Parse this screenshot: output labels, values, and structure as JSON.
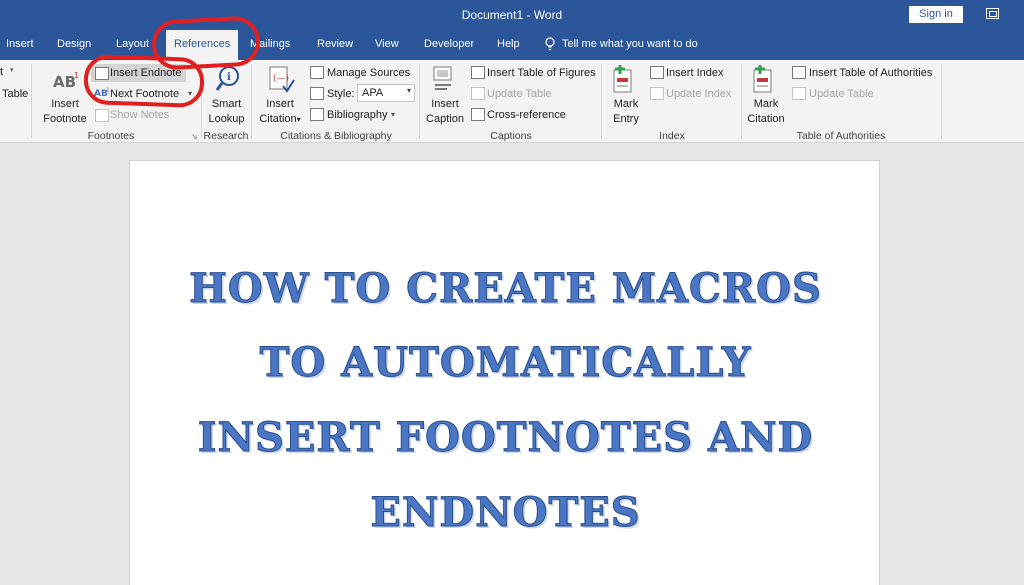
{
  "titlebar": {
    "doc_title": "Document1  -  Word",
    "signin_label": "Sign in"
  },
  "tabs": [
    {
      "label": "Insert"
    },
    {
      "label": "Design"
    },
    {
      "label": "Layout"
    },
    {
      "label": "References"
    },
    {
      "label": "Mailings"
    },
    {
      "label": "Review"
    },
    {
      "label": "View"
    },
    {
      "label": "Developer"
    },
    {
      "label": "Help"
    }
  ],
  "tell_me": "Tell me what you want to do",
  "ribbon": {
    "toc": {
      "partial_top": "t",
      "partial_table": "Table"
    },
    "footnotes": {
      "insert_footnote_1": "Insert",
      "insert_footnote_2": "Footnote",
      "insert_endnote": "Insert Endnote",
      "next_footnote": "Next Footnote",
      "show_notes": "Show Notes",
      "group_label": "Footnotes"
    },
    "research": {
      "smart_lookup_1": "Smart",
      "smart_lookup_2": "Lookup",
      "group_label": "Research"
    },
    "citations": {
      "insert_citation_1": "Insert",
      "insert_citation_2": "Citation",
      "manage_sources": "Manage Sources",
      "style_label": "Style:",
      "style_value": "APA",
      "bibliography": "Bibliography",
      "group_label": "Citations & Bibliography"
    },
    "captions": {
      "insert_caption_1": "Insert",
      "insert_caption_2": "Caption",
      "insert_table_of_figures": "Insert Table of Figures",
      "update_table": "Update Table",
      "cross_reference": "Cross-reference",
      "group_label": "Captions"
    },
    "index": {
      "mark_entry_1": "Mark",
      "mark_entry_2": "Entry",
      "insert_index": "Insert Index",
      "update_index": "Update Index",
      "group_label": "Index"
    },
    "toa": {
      "mark_citation_1": "Mark",
      "mark_citation_2": "Citation",
      "insert_toa": "Insert Table of Authorities",
      "update_table": "Update Table",
      "group_label": "Table of Authorities"
    }
  },
  "document": {
    "lines": [
      "HOW TO CREATE MACROS",
      "TO AUTOMATICALLY",
      "INSERT FOOTNOTES AND",
      "ENDNOTES"
    ]
  },
  "colors": {
    "title_bar": "#2b579a",
    "ribbon_bg": "#f3f3f3",
    "heading_text": "#4a76c4",
    "annotation": "#e02020"
  }
}
